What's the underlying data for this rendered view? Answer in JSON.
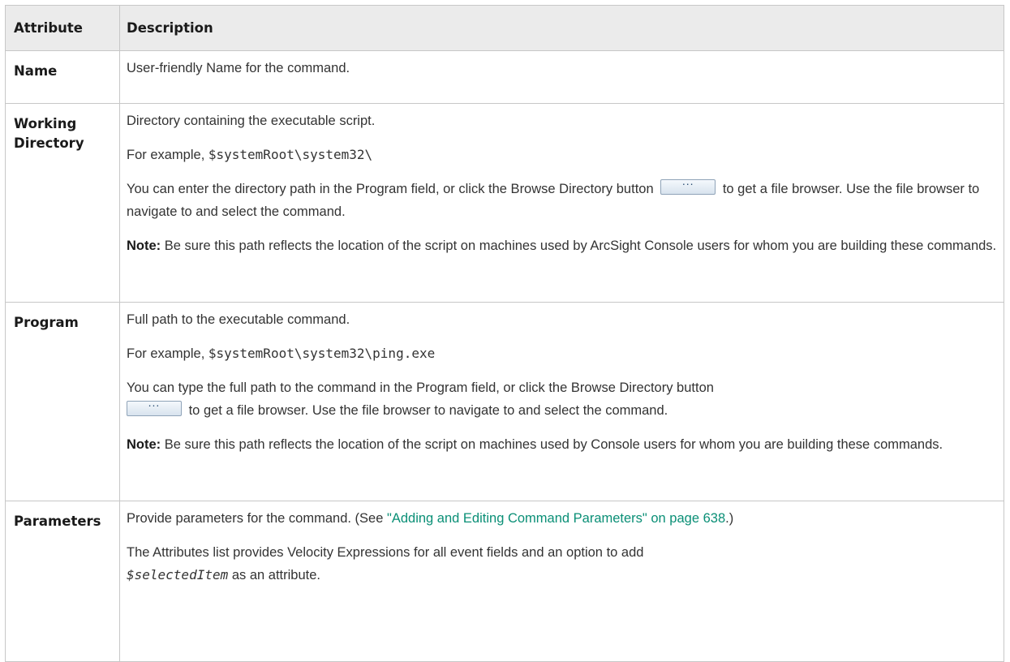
{
  "headers": {
    "attribute": "Attribute",
    "description": "Description"
  },
  "rows": {
    "name": {
      "attribute": "Name",
      "description": "User-friendly Name for the command."
    },
    "working_directory": {
      "attribute_line1": "Working",
      "attribute_line2": "Directory",
      "p1": "Directory containing the executable script.",
      "p2_prefix": "For example, ",
      "p2_code": "$systemRoot\\system32\\",
      "p3_before": "You can enter the directory path in the Program field, or click the Browse Directory button",
      "p3_after": "to get a file browser. Use the file browser to navigate to and select the command.",
      "button_label": "...",
      "note_label": "Note:",
      "note_text": " Be sure this path reflects the location of the script on machines used by ArcSight Console users for whom you are building these commands."
    },
    "program": {
      "attribute": "Program",
      "p1": "Full path to the executable command.",
      "p2_prefix": "For example, ",
      "p2_code": "$systemRoot\\system32\\ping.exe",
      "p3_before": "You can type the full path to the command in the Program field, or click the Browse Directory button",
      "p3_after": "to get a file browser. Use the file browser to navigate to and select the command.",
      "button_label": "...",
      "note_label": "Note:",
      "note_text": " Be sure this path reflects the location of the script on machines used by Console users for whom you are building these commands."
    },
    "parameters": {
      "attribute": "Parameters",
      "p1_before": "Provide parameters for the command. (See ",
      "p1_link": "\"Adding and Editing Command Parameters\" on page 638",
      "p1_after": ".)",
      "p2_before": "The Attributes list provides Velocity Expressions for all event fields and an option to add",
      "p2_code": "$selectedItem",
      "p2_after": " as an attribute."
    }
  },
  "colors": {
    "link": "#0a8f76",
    "header_bg": "#ebebeb",
    "border": "#c7c7c7"
  }
}
